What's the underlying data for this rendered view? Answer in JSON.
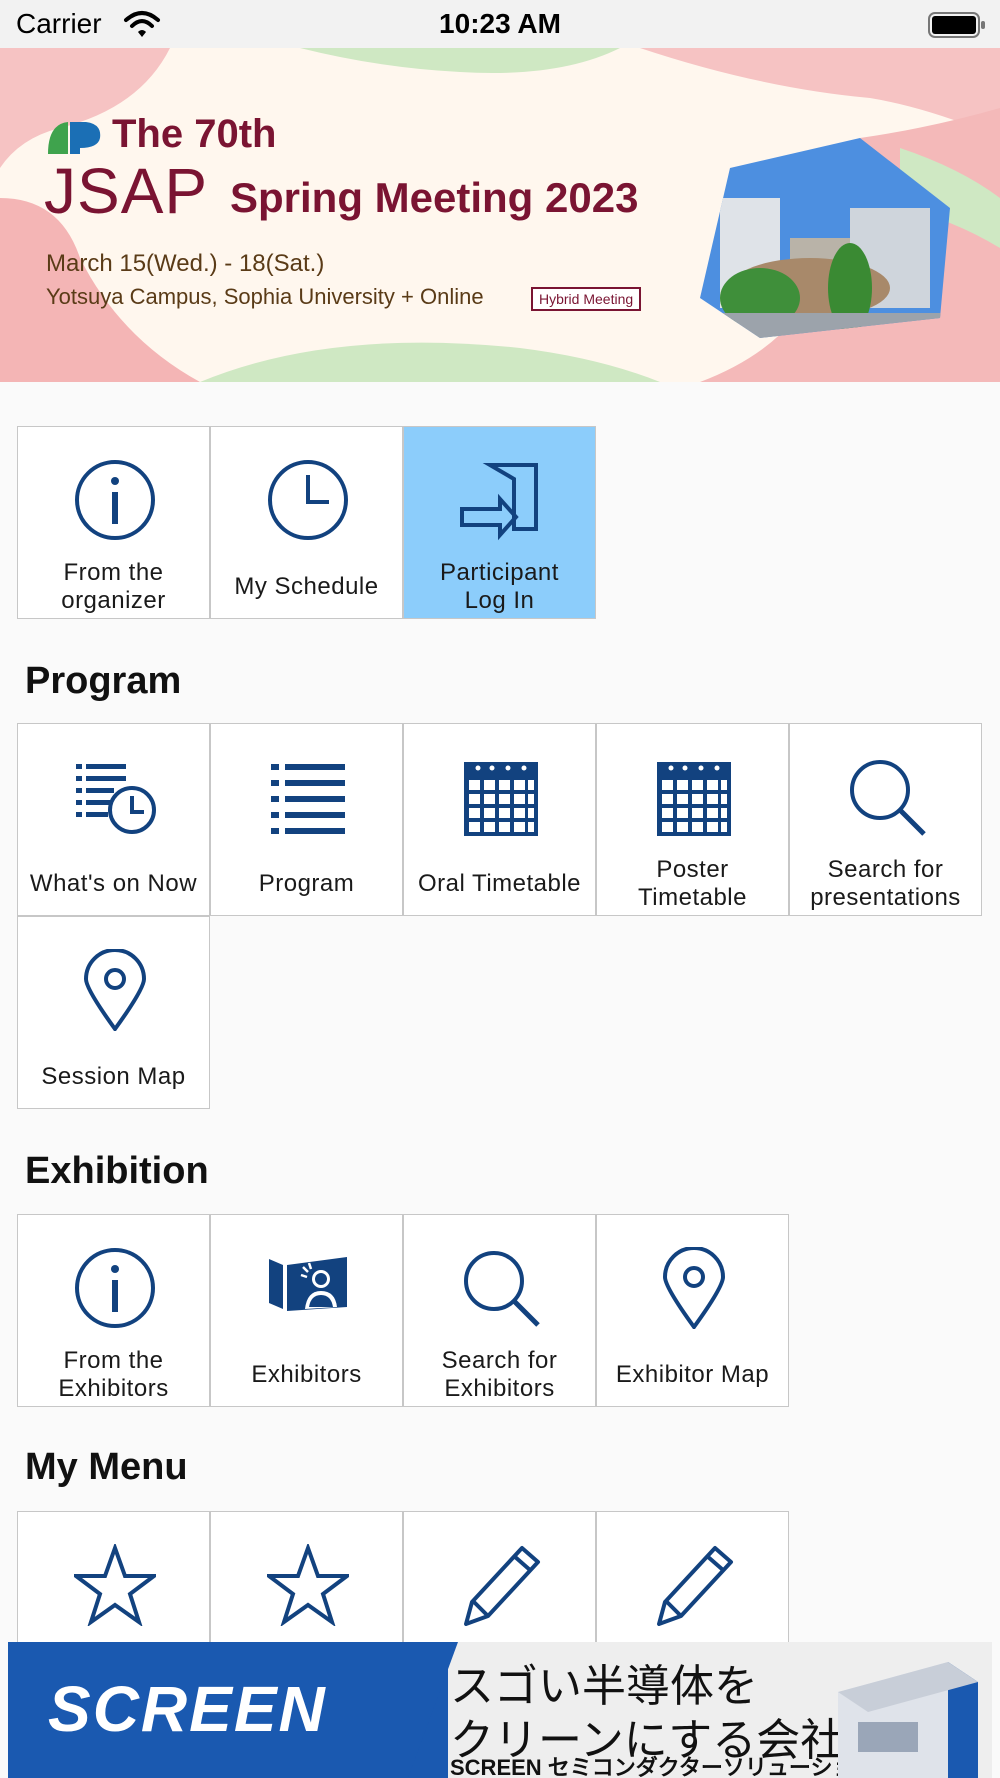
{
  "status_bar": {
    "carrier": "Carrier",
    "time": "10:23 AM"
  },
  "banner": {
    "edition": "The 70th",
    "org": "JSAP",
    "meeting": "Spring Meeting 2023",
    "dates": "March 15(Wed.) - 18(Sat.)",
    "venue": "Yotsuya Campus, Sophia University + Online",
    "badge": "Hybrid Meeting"
  },
  "top_tiles": [
    {
      "label": "From the\norganizer",
      "icon": "info-icon"
    },
    {
      "label": "My Schedule",
      "icon": "clock-icon"
    },
    {
      "label": "Participant\nLog In",
      "icon": "login-icon"
    }
  ],
  "sections": {
    "program": {
      "title": "Program",
      "tiles": [
        {
          "label": "What's on Now",
          "icon": "list-clock-icon"
        },
        {
          "label": "Program",
          "icon": "list-icon"
        },
        {
          "label": "Oral Timetable",
          "icon": "calendar-icon"
        },
        {
          "label": "Poster\nTimetable",
          "icon": "calendar-icon"
        },
        {
          "label": "Search for\npresentations",
          "icon": "search-icon"
        },
        {
          "label": "Session Map",
          "icon": "map-pin-icon"
        }
      ]
    },
    "exhibition": {
      "title": "Exhibition",
      "tiles": [
        {
          "label": "From the\nExhibitors",
          "icon": "info-icon"
        },
        {
          "label": "Exhibitors",
          "icon": "exhibitor-booth-icon"
        },
        {
          "label": "Search for\nExhibitors",
          "icon": "search-icon"
        },
        {
          "label": "Exhibitor Map",
          "icon": "map-pin-icon"
        }
      ]
    },
    "my_menu": {
      "title": "My Menu",
      "tiles": [
        {
          "label": "",
          "icon": "star-icon"
        },
        {
          "label": "",
          "icon": "star-icon"
        },
        {
          "label": "",
          "icon": "pencil-icon"
        },
        {
          "label": "",
          "icon": "pencil-icon"
        }
      ]
    }
  },
  "ad": {
    "logo_text": "SCREEN",
    "jp_line1": "スゴい半導体を",
    "jp_line2": "クリーンにする会社。",
    "brand_line": "SCREEN セミコンダクターソリューションズ"
  },
  "colors": {
    "icon": "#12427f",
    "selected_tile": "#8ccdfb",
    "banner_text": "#7a1432"
  }
}
